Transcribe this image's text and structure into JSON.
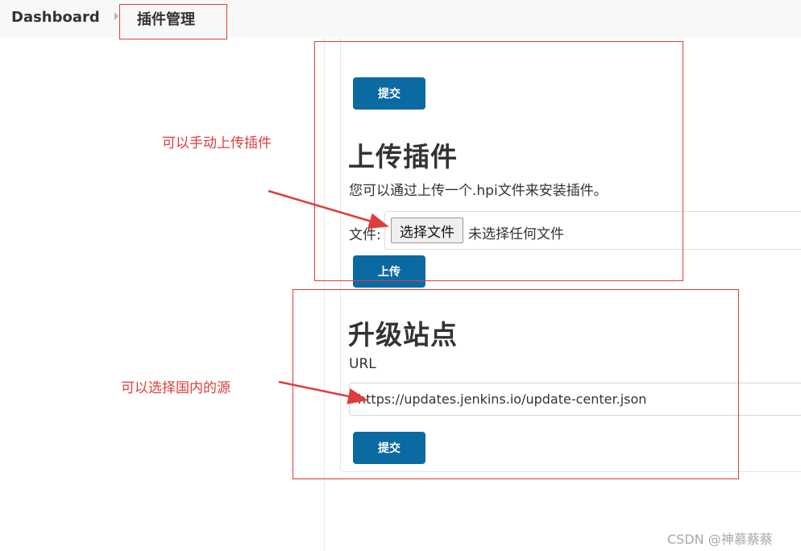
{
  "breadcrumb": {
    "home": "Dashboard",
    "current": "插件管理"
  },
  "top_submit": {
    "label": "提交"
  },
  "upload_section": {
    "title": "上传插件",
    "description": "您可以通过上传一个.hpi文件来安装插件。",
    "file_label": "文件:",
    "choose_file_button": "选择文件",
    "file_status": "未选择任何文件",
    "upload_button": "上传"
  },
  "update_site_section": {
    "title": "升级站点",
    "url_label": "URL",
    "url_value": "https://updates.jenkins.io/update-center.json",
    "submit_button": "提交"
  },
  "annotations": {
    "upload_note": "可以手动上传插件",
    "source_note": "可以选择国内的源",
    "color": "#e03c3c"
  },
  "colors": {
    "button_primary": "#0b6aa2"
  },
  "watermark": "CSDN @神慕蔡蔡"
}
